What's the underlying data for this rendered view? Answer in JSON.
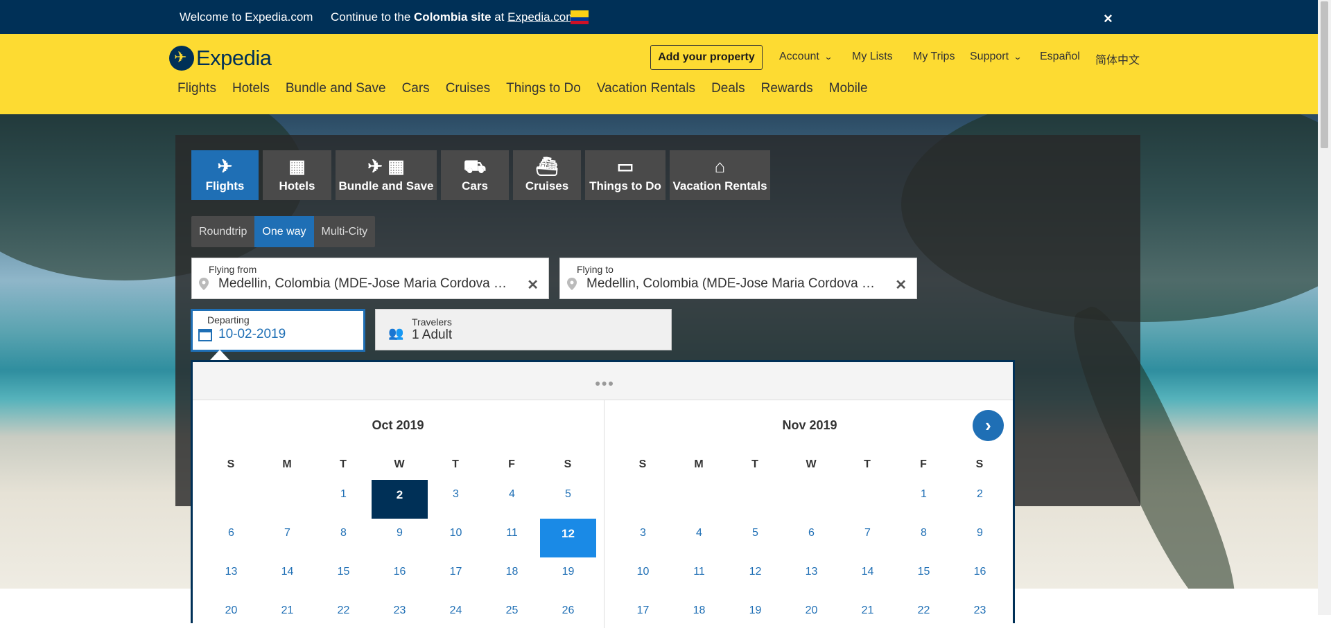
{
  "topbar": {
    "welcome": "Welcome to Expedia.com",
    "continue_prefix": "Continue to the ",
    "continue_bold": "Colombia site",
    "continue_at": " at ",
    "continue_link": "Expedia.com",
    "close": "×"
  },
  "header": {
    "logo_text": "Expedia",
    "add_property": "Add your property",
    "account": "Account",
    "my_lists": "My Lists",
    "my_trips": "My Trips",
    "support": "Support",
    "espanol": "Español",
    "chinese": "简体中文",
    "nav": [
      "Flights",
      "Hotels",
      "Bundle and Save",
      "Cars",
      "Cruises",
      "Things to Do",
      "Vacation Rentals",
      "Deals",
      "Rewards",
      "Mobile"
    ]
  },
  "search": {
    "tabs": [
      "Flights",
      "Hotels",
      "Bundle and Save",
      "Cars",
      "Cruises",
      "Things to Do",
      "Vacation Rentals"
    ],
    "trip_types": [
      "Roundtrip",
      "One way",
      "Multi-City"
    ],
    "from_label": "Flying from",
    "from_value": "Medellin, Colombia (MDE-Jose Maria Cordova Intl.)",
    "to_label": "Flying to",
    "to_value": "Medellin, Colombia (MDE-Jose Maria Cordova Intl.)",
    "departing_label": "Departing",
    "departing_value": "10-02-2019",
    "travelers_label": "Travelers",
    "travelers_value": "1 Adult"
  },
  "calendar": {
    "left_title": "Oct 2019",
    "right_title": "Nov 2019",
    "weekdays": [
      "S",
      "M",
      "T",
      "W",
      "T",
      "F",
      "S"
    ],
    "selected_day": "2",
    "today_day": "12",
    "oct_rows": [
      [
        "",
        "",
        "1",
        "2",
        "3",
        "4",
        "5"
      ],
      [
        "6",
        "7",
        "8",
        "9",
        "10",
        "11",
        "12"
      ],
      [
        "13",
        "14",
        "15",
        "16",
        "17",
        "18",
        "19"
      ],
      [
        "20",
        "21",
        "22",
        "23",
        "24",
        "25",
        "26"
      ]
    ],
    "nov_rows": [
      [
        "",
        "",
        "",
        "",
        "",
        "1",
        "2"
      ],
      [
        "3",
        "4",
        "5",
        "6",
        "7",
        "8",
        "9"
      ],
      [
        "10",
        "11",
        "12",
        "13",
        "14",
        "15",
        "16"
      ],
      [
        "17",
        "18",
        "19",
        "20",
        "21",
        "22",
        "23"
      ]
    ]
  },
  "colors": {
    "brand_yellow": "#fddb32",
    "navy": "#003057",
    "blue": "#1f6fb5",
    "today_blue": "#1a8ae6"
  }
}
